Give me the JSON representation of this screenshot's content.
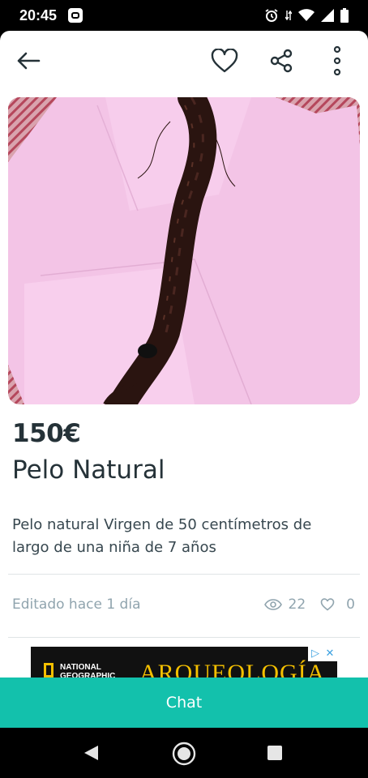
{
  "status_bar": {
    "time": "20:45"
  },
  "listing": {
    "price": "150€",
    "title": "Pelo Natural",
    "description": "Pelo natural Virgen de 50 centímetros de largo de una niña de 7 años",
    "edited": "Editado hace 1 día",
    "views": "22",
    "likes": "0"
  },
  "ad": {
    "brand_line1": "NATIONAL",
    "brand_line2": "GEOGRAPHIC",
    "headline": "ARQUEOLOGÍA"
  },
  "actions": {
    "chat_label": "Chat"
  },
  "colors": {
    "accent": "#13c1ac",
    "text_dark": "#253238",
    "muted": "#90a4ae"
  },
  "icons": {
    "back": "arrow-left-icon",
    "favorite": "heart-icon",
    "share": "share-icon",
    "more": "more-vertical-icon",
    "views": "eye-icon",
    "likes": "heart-outline-icon"
  }
}
